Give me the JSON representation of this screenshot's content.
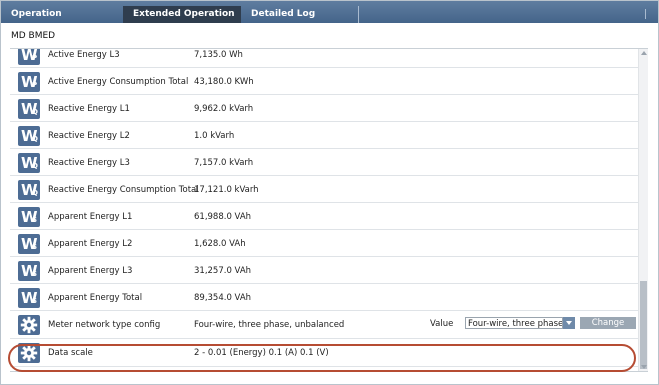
{
  "tabs": [
    {
      "label": "Operation"
    },
    {
      "label": "Extended Operation"
    },
    {
      "label": "Detailed Log"
    }
  ],
  "device": {
    "title": "MD BMED"
  },
  "rows": [
    {
      "icon": "W",
      "sub": "P",
      "label": "Active Energy L3",
      "value": "7,135.0 Wh"
    },
    {
      "icon": "W",
      "sub": "P",
      "label": "Active Energy Consumption Total",
      "value": "43,180.0 KWh"
    },
    {
      "icon": "W",
      "sub": "Q",
      "label": "Reactive Energy  L1",
      "value": "9,962.0 kVarh"
    },
    {
      "icon": "W",
      "sub": "Q",
      "label": "Reactive Energy  L2",
      "value": "1.0 kVarh"
    },
    {
      "icon": "W",
      "sub": "Q",
      "label": "Reactive Energy  L3",
      "value": "7,157.0 kVarh"
    },
    {
      "icon": "W",
      "sub": "Q",
      "label": "Reactive Energy Consumption Total",
      "value": "17,121.0 kVarh"
    },
    {
      "icon": "W",
      "sub": "S",
      "label": "Apparent Energy L1",
      "value": "61,988.0 VAh"
    },
    {
      "icon": "W",
      "sub": "S",
      "label": "Apparent Energy L2",
      "value": "1,628.0 VAh"
    },
    {
      "icon": "W",
      "sub": "S",
      "label": "Apparent Energy L3",
      "value": "31,257.0 VAh"
    },
    {
      "icon": "W",
      "sub": "S",
      "label": "Apparent Energy Total",
      "value": "89,354.0 VAh"
    }
  ],
  "config_row": {
    "label": "Meter network type config",
    "value": "Four-wire, three phase, unbalanced",
    "control_label": "Value",
    "select_value": "Four-wire, three phase, u",
    "button_label": "Change"
  },
  "scale_row": {
    "label": "Data scale",
    "value": "2 - 0.01 (Energy) 0.1 (A) 0.1 (V)"
  },
  "colors": {
    "tab_bar": "#4f6f94",
    "active_tab": "#2f3d4e",
    "icon_bg": "#4d6c94",
    "highlight": "#b64c33"
  }
}
